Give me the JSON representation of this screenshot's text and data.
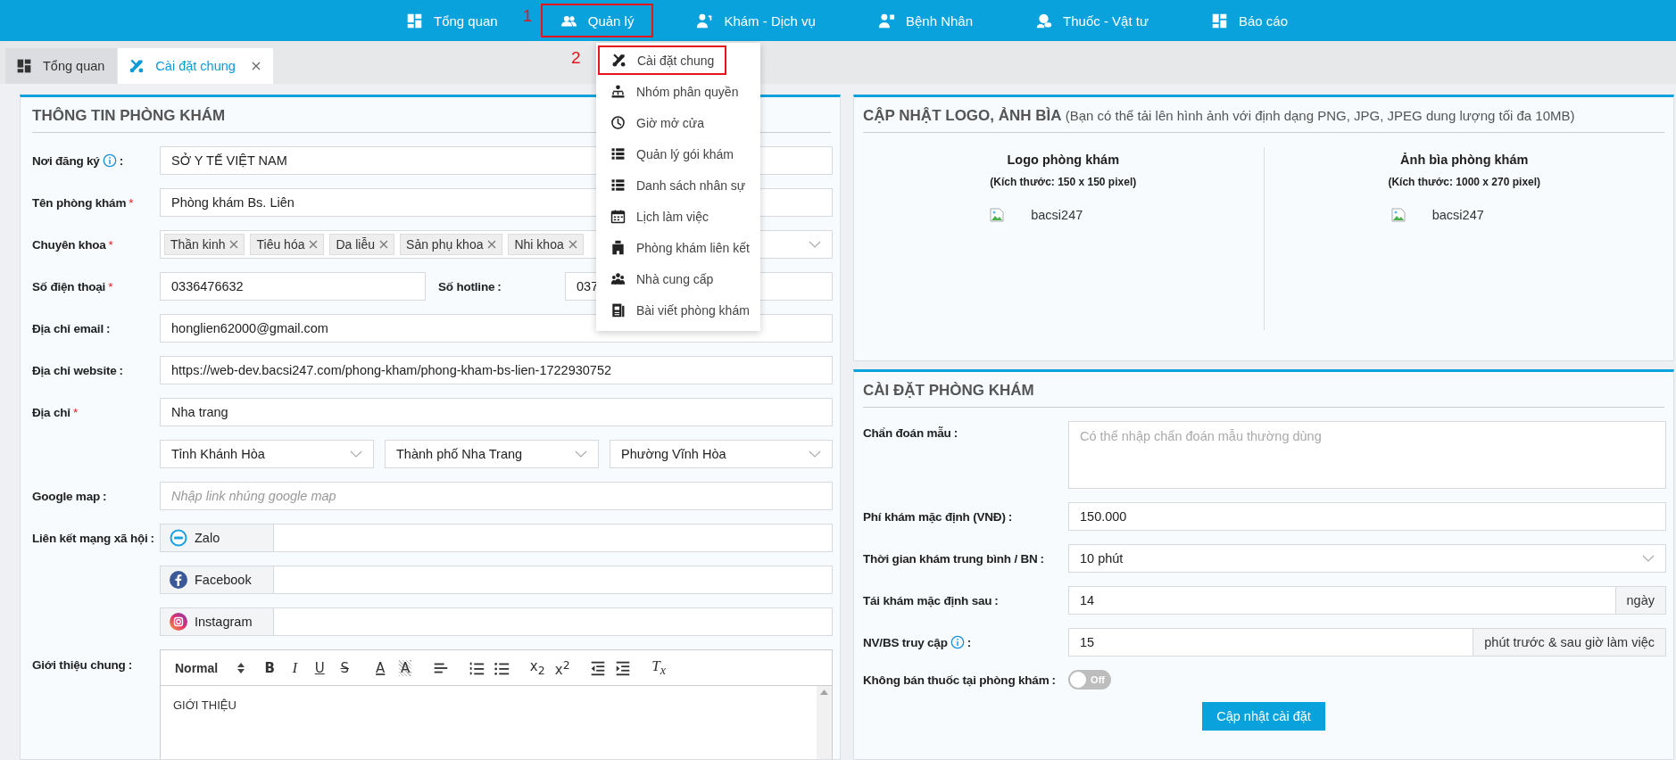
{
  "top_nav": {
    "items": [
      {
        "label": "Tổng quan"
      },
      {
        "label": "Quản lý",
        "annotation": "1"
      },
      {
        "label": "Khám - Dịch vụ"
      },
      {
        "label": "Bệnh Nhân"
      },
      {
        "label": "Thuốc - Vật tư"
      },
      {
        "label": "Báo cáo"
      }
    ]
  },
  "tabs": [
    {
      "label": "Tổng quan",
      "selected": false,
      "closable": false
    },
    {
      "label": "Cài đặt chung",
      "selected": true,
      "closable": true
    }
  ],
  "dropdown_menu": {
    "items": [
      {
        "label": "Cài đặt chung",
        "annotation": "2"
      },
      {
        "label": "Nhóm phân quyền"
      },
      {
        "label": "Giờ mở cửa"
      },
      {
        "label": "Quản lý gói khám"
      },
      {
        "label": "Danh sách nhân sự"
      },
      {
        "label": "Lịch làm việc"
      },
      {
        "label": "Phòng khám liên kết"
      },
      {
        "label": "Nhà cung cấp"
      },
      {
        "label": "Bài viết phòng khám"
      }
    ]
  },
  "clinic_info": {
    "title": "THÔNG TIN PHÒNG KHÁM",
    "rows": [
      {
        "kind": "text",
        "label": "Nơi đăng ký",
        "info": true,
        "suffix": ":",
        "value": "SỞ Y TẾ VIỆT NAM"
      },
      {
        "kind": "text",
        "label": "Tên phòng khám",
        "required_mark": "*",
        "value": "Phòng khám Bs. Liên"
      },
      {
        "kind": "tags",
        "label": "Chuyên khoa",
        "required_mark": "*",
        "tags": [
          "Thần kinh",
          "Tiêu hóa",
          "Da liễu",
          "Sản phụ khoa",
          "Nhi khoa"
        ]
      },
      {
        "kind": "pair",
        "label": "Số điện thoại",
        "required_mark": "*",
        "value": "0336476632",
        "label_2": "Số hotline",
        "suffix_2": ":",
        "value_2": "037"
      },
      {
        "kind": "text",
        "label": "Địa chỉ email",
        "suffix": ":",
        "value": "honglien62000@gmail.com"
      },
      {
        "kind": "text",
        "label": "Địa chỉ website",
        "suffix": ":",
        "value": "https://web-dev.bacsi247.com/phong-kham/phong-kham-bs-lien-1722930752"
      },
      {
        "kind": "text",
        "label": "Địa chỉ",
        "required_mark": "*",
        "value": "Nha trang"
      },
      {
        "kind": "selects",
        "values": [
          "Tỉnh Khánh Hòa",
          "Thành phố Nha Trang",
          "Phường Vĩnh Hòa"
        ]
      },
      {
        "kind": "text",
        "label": "Google map",
        "suffix": ":",
        "placeholder": "Nhập link nhúng google map"
      },
      {
        "kind": "social",
        "label": "Liên kết mạng xã hội",
        "suffix": ":",
        "network": "Zalo"
      },
      {
        "kind": "social",
        "network": "Facebook"
      },
      {
        "kind": "social",
        "network": "Instagram"
      },
      {
        "kind": "editor",
        "label": "Giới thiệu chung",
        "suffix": ":",
        "content": "GIỚI THIỆU",
        "toolbar": [
          {
            "kind": "select",
            "label": "Normal"
          },
          {
            "kind": "bold",
            "label": "B"
          },
          {
            "kind": "italic",
            "label": "I"
          },
          {
            "kind": "underline",
            "label": "U"
          },
          {
            "kind": "strike",
            "label": "S"
          },
          {
            "kind": "color",
            "label": "A"
          },
          {
            "kind": "highlight",
            "label": "A"
          },
          {
            "kind": "align"
          },
          {
            "kind": "ordered"
          },
          {
            "kind": "bullet"
          },
          {
            "kind": "script",
            "label": "x$_{2}$"
          },
          {
            "kind": "script",
            "label": "x$^{2}$"
          },
          {
            "kind": "outdent"
          },
          {
            "kind": "indent"
          },
          {
            "kind": "clear",
            "label": "T$_{x}$"
          }
        ]
      }
    ]
  },
  "media": {
    "title": "CẬP NHẬT LOGO, ẢNH BÌA",
    "note": "(Bạn có thể tải lên hình ảnh với định dạng PNG, JPG, JPEG dung lượng tối đa 10MB)",
    "items": [
      {
        "title": "Logo phòng khám",
        "size": "(Kích thước: 150 x 150 pixel)",
        "alt": "bacsi247"
      },
      {
        "title": "Ảnh bìa phòng khám",
        "size": "(Kích thước: 1000 x 270 pixel)",
        "alt": "bacsi247"
      }
    ]
  },
  "settings": {
    "title": "CÀI ĐẶT PHÒNG KHÁM",
    "rows": [
      {
        "kind": "textarea",
        "label": "Chẩn đoán mẫu",
        "suffix": ":",
        "placeholder": "Có thể nhập chẩn đoán mẫu thường dùng"
      },
      {
        "kind": "text",
        "label": "Phí khám mặc định (VNĐ)",
        "suffix": ":",
        "value": "150.000"
      },
      {
        "kind": "select",
        "label": "Thời gian khám trung bình / BN",
        "suffix": ":",
        "value": "10 phút"
      },
      {
        "kind": "addon",
        "label": "Tái khám mặc định sau",
        "suffix": ":",
        "value": "14",
        "addon": "ngày"
      },
      {
        "kind": "addon",
        "label": "NV/BS truy cập",
        "info": true,
        "suffix": ":",
        "value": "15",
        "addon": "phút trước & sau giờ làm việc"
      },
      {
        "kind": "toggle",
        "label": "Không bán thuốc tại phòng khám",
        "suffix": ":",
        "on": false,
        "state_text": "Off"
      }
    ],
    "button": "Cập nhật cài đặt"
  }
}
